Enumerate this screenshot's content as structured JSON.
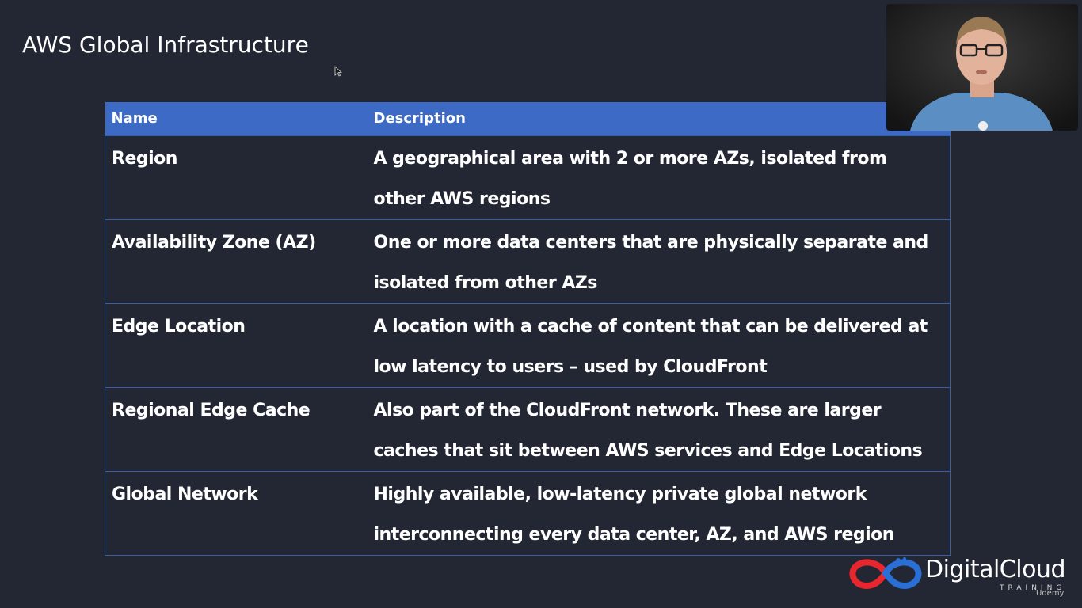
{
  "slide": {
    "title": "AWS Global Infrastructure"
  },
  "table": {
    "headers": {
      "name": "Name",
      "description": "Description"
    },
    "rows": [
      {
        "name": "Region",
        "description": "A geographical area with 2 or more AZs, isolated from other AWS regions"
      },
      {
        "name": "Availability Zone (AZ)",
        "description": "One or more data centers that are physically separate and isolated from other AZs"
      },
      {
        "name": "Edge Location",
        "description": "A location with a cache of content that can be delivered at low latency to users – used by CloudFront"
      },
      {
        "name": "Regional Edge Cache",
        "description": "Also part of the CloudFront network. These are larger caches that sit between AWS services and Edge Locations"
      },
      {
        "name": "Global Network",
        "description": "Highly available, low-latency private global network interconnecting every data center, AZ, and AWS region"
      }
    ]
  },
  "branding": {
    "name": "DigitalCloud",
    "sub": "TRAINING",
    "platform": "Udemy"
  },
  "colors": {
    "background": "#222733",
    "header": "#3c6ac4",
    "border": "#3a5e9e",
    "logo_red": "#e8262d",
    "logo_blue": "#2a6fd6"
  },
  "icons": {
    "cursor": "mouse-pointer-icon",
    "logo": "digitalcloud-swirl-icon"
  }
}
